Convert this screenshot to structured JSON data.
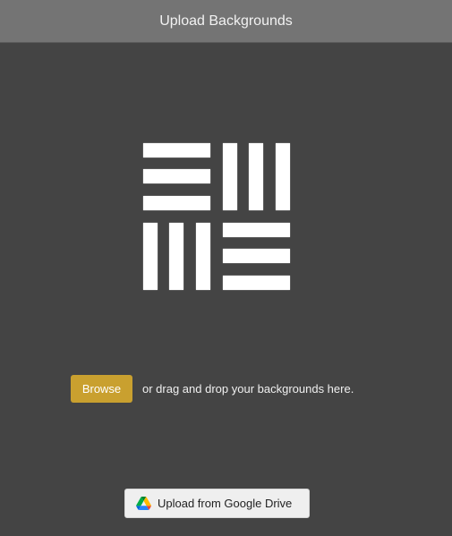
{
  "header": {
    "title": "Upload Backgrounds"
  },
  "main": {
    "logo_icon": "basket-weave-pattern-icon",
    "browse_label": "Browse",
    "drop_hint": "or drag and drop your backgrounds here.",
    "google_drive_label": "Upload from Google Drive",
    "google_drive_icon": "google-drive-icon"
  },
  "colors": {
    "header_bg": "#747474",
    "body_bg": "#444444",
    "browse_button": "#c9a02f",
    "google_drive_button": "#efefef"
  }
}
